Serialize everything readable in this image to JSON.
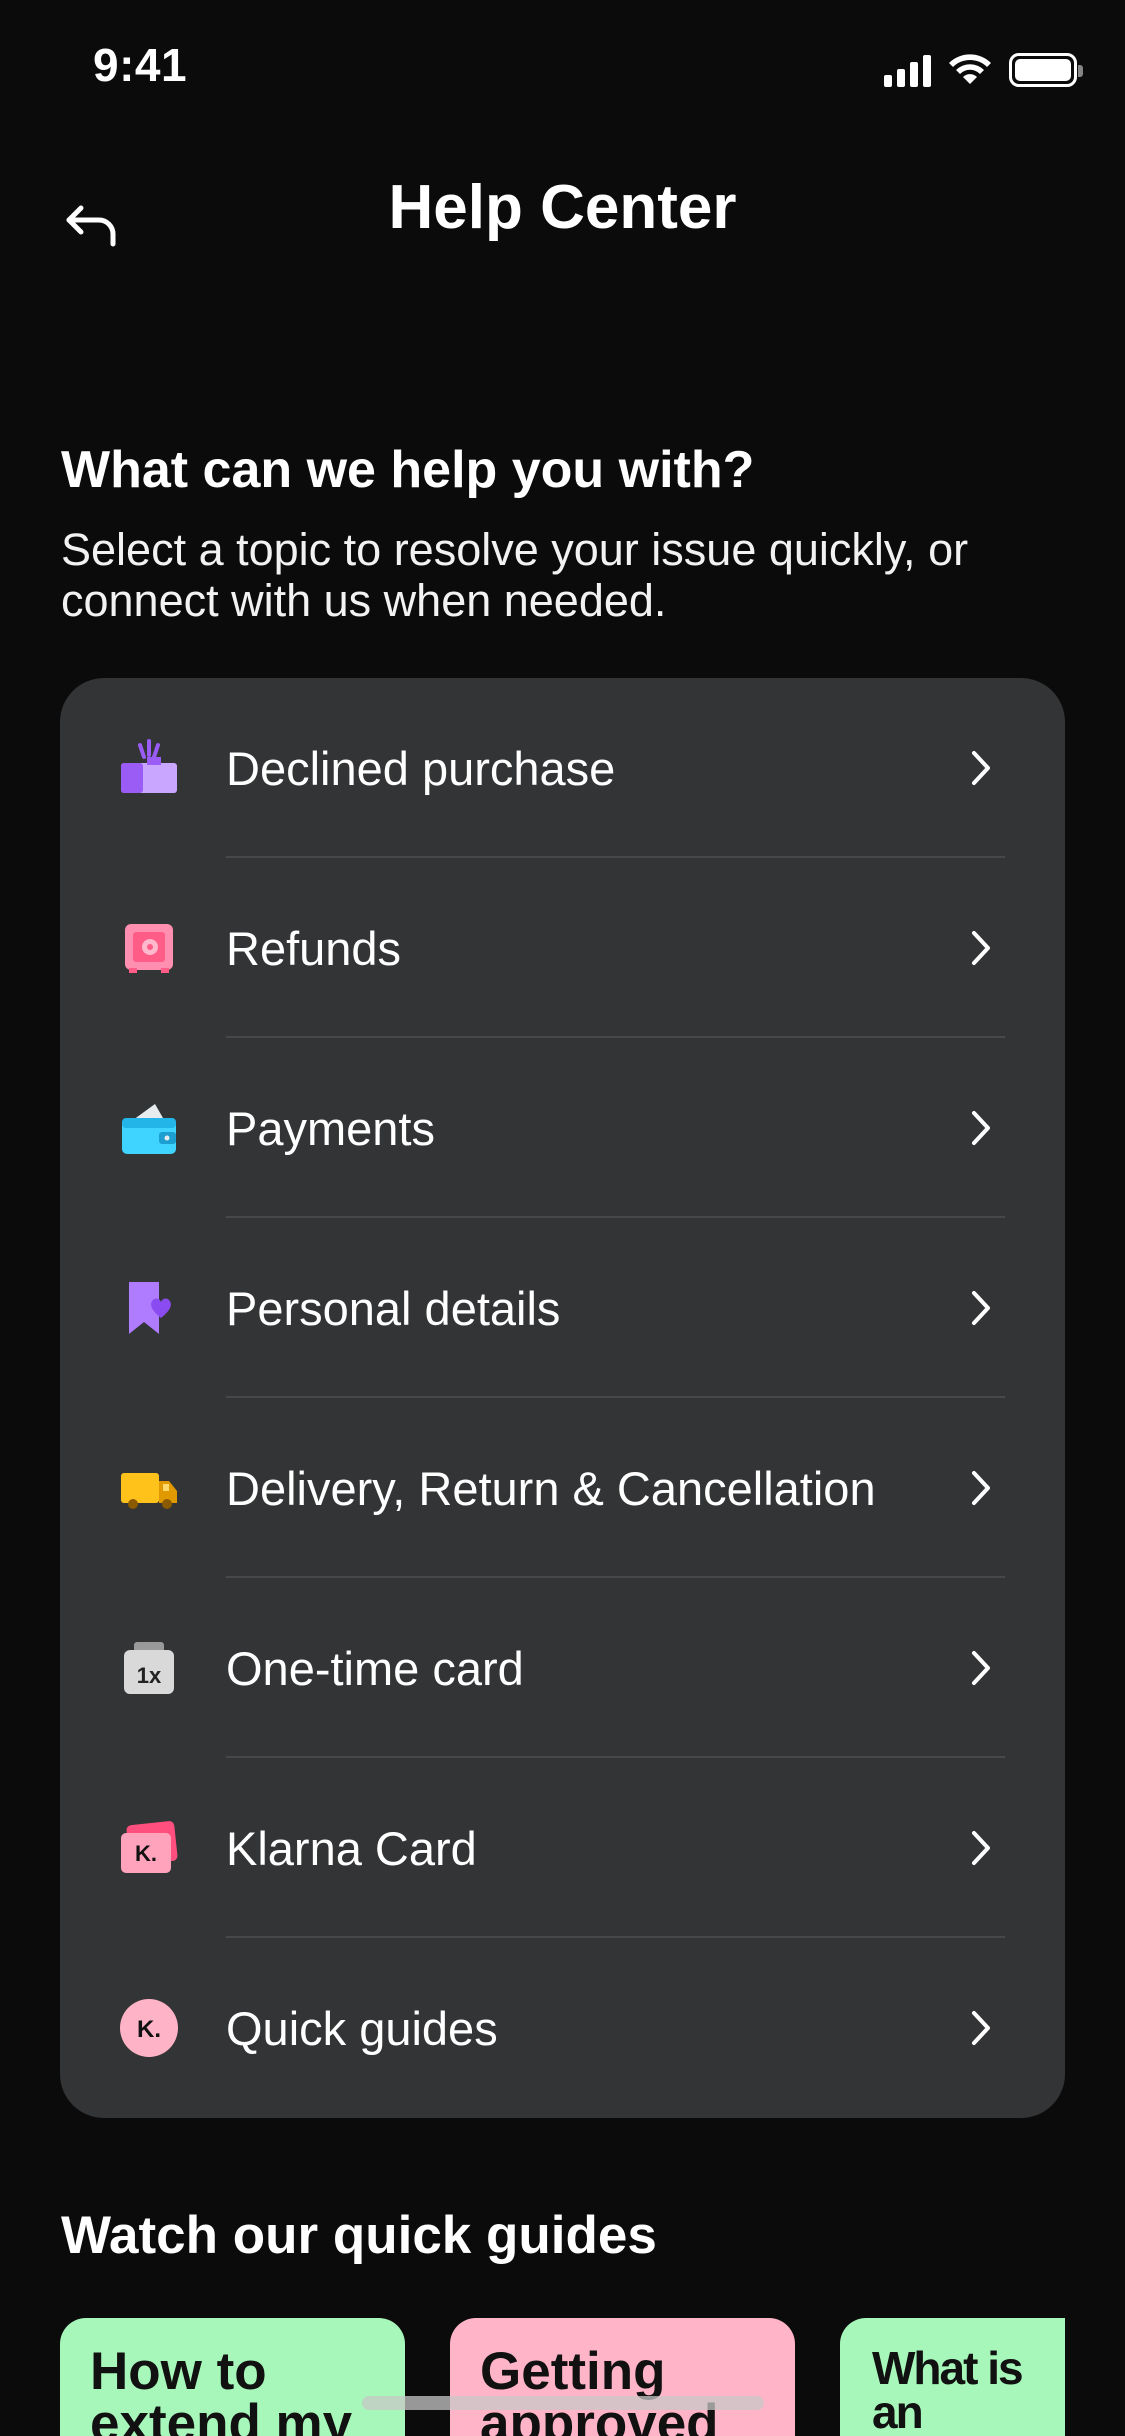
{
  "status_bar": {
    "time": "9:41"
  },
  "nav": {
    "title": "Help Center"
  },
  "intro": {
    "heading": "What can we help you with?",
    "subtitle": "Select a topic to resolve your issue quickly, or connect with us when needed."
  },
  "topics": [
    {
      "label": "Declined purchase",
      "icon": "declined-purchase-icon"
    },
    {
      "label": "Refunds",
      "icon": "safe-icon"
    },
    {
      "label": "Payments",
      "icon": "wallet-icon"
    },
    {
      "label": "Personal details",
      "icon": "bookmark-heart-icon"
    },
    {
      "label": "Delivery, Return & Cancellation",
      "icon": "truck-icon"
    },
    {
      "label": "One-time card",
      "icon": "one-time-card-icon"
    },
    {
      "label": "Klarna Card",
      "icon": "klarna-card-icon"
    },
    {
      "label": "Quick guides",
      "icon": "klarna-badge-icon"
    }
  ],
  "guides": {
    "heading": "Watch our quick guides",
    "cards": [
      {
        "title": "How to extend my"
      },
      {
        "title": "Getting approved to"
      },
      {
        "title": "What is an authorisation hold?"
      }
    ]
  },
  "colors": {
    "background": "#0b0b0c",
    "card": "#333435",
    "guide_green": "#a6f7b9",
    "guide_pink": "#ffb4c8"
  }
}
